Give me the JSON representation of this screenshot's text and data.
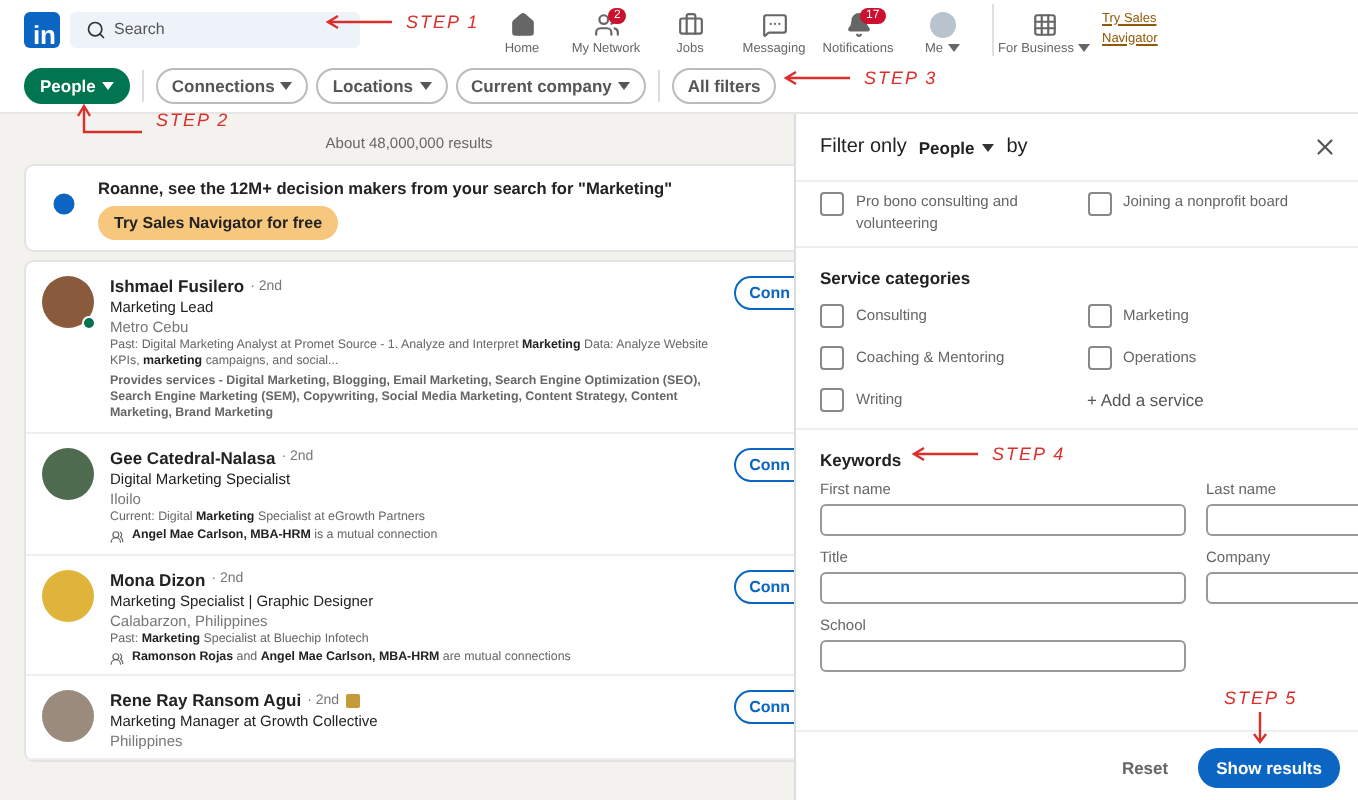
{
  "nav": {
    "logo": "in",
    "search": {
      "placeholder": "Search"
    },
    "items": [
      {
        "kind": "home",
        "label": "Home"
      },
      {
        "kind": "network",
        "label": "My Network",
        "badge": "2"
      },
      {
        "kind": "jobs",
        "label": "Jobs"
      },
      {
        "kind": "messaging",
        "label": "Messaging"
      },
      {
        "kind": "notifications",
        "label": "Notifications",
        "badge": "17"
      },
      {
        "kind": "me",
        "label": "Me"
      },
      {
        "kind": "business",
        "label": "For Business"
      }
    ],
    "premium_link": "Try Sales Navigator"
  },
  "filters": [
    {
      "label": "People",
      "selected": true,
      "dropdown": true
    },
    {
      "label": "Connections",
      "selected": false,
      "dropdown": true
    },
    {
      "label": "Locations",
      "selected": false,
      "dropdown": true
    },
    {
      "label": "Current company",
      "selected": false,
      "dropdown": true
    },
    {
      "label": "All filters",
      "selected": false,
      "dropdown": false
    }
  ],
  "results_count": "About 48,000,000 results",
  "promo": {
    "text": "Roanne, see the 12M+ decision makers from your search for \"Marketing\"",
    "button": "Try Sales Navigator for free"
  },
  "results": [
    {
      "name": "Ishmael Fusilero",
      "degree": "· 2nd",
      "online": true,
      "headline": "Marketing Lead",
      "location": "Metro Cebu",
      "snippet": "Past: Digital Marketing Analyst at Promet Source - 1. Analyze and Interpret **Marketing** Data: Analyze Website KPIs, **marketing** campaigns, and social...",
      "services": "Provides services - Digital Marketing, Blogging, Email Marketing, Search Engine Optimization (SEO), Search Engine Marketing (SEM), Copywriting, Social Media Marketing, Content Strategy, Content Marketing, Brand Marketing",
      "action": "Conn"
    },
    {
      "name": "Gee Catedral-Nalasa",
      "degree": "· 2nd",
      "headline": "Digital Marketing Specialist",
      "location": "Iloilo",
      "snippet": "Current: Digital **Marketing** Specialist at eGrowth Partners",
      "mutual": "**Angel Mae Carlson, MBA-HRM** is a mutual connection",
      "action": "Conn"
    },
    {
      "name": "Mona Dizon",
      "degree": "· 2nd",
      "headline": "Marketing Specialist | Graphic Designer",
      "location": "Calabarzon, Philippines",
      "snippet": "Past: **Marketing** Specialist at Bluechip Infotech",
      "mutual": "**Ramonson Rojas** and **Angel Mae Carlson, MBA-HRM** are mutual connections",
      "action": "Conn"
    },
    {
      "name": "Rene Ray Ransom Agui",
      "degree": "· 2nd",
      "premium": true,
      "headline": "Marketing Manager at Growth Collective",
      "location": "Philippines",
      "action": "Conn"
    }
  ],
  "panel": {
    "title_start": "Filter only",
    "entity": "People",
    "title_end": "by",
    "top_options": [
      {
        "label": "Pro bono consulting and volunteering",
        "checked": false
      },
      {
        "label": "Joining a nonprofit board",
        "checked": false
      }
    ],
    "service_heading": "Service categories",
    "services": [
      {
        "label": "Consulting",
        "checked": false
      },
      {
        "label": "Marketing",
        "checked": false
      },
      {
        "label": "Coaching & Mentoring",
        "checked": false
      },
      {
        "label": "Operations",
        "checked": false
      },
      {
        "label": "Writing",
        "checked": false
      }
    ],
    "add_service": "+ Add a service",
    "keywords_heading": "Keywords",
    "fields": [
      {
        "label": "First name"
      },
      {
        "label": "Last name"
      },
      {
        "label": "Title"
      },
      {
        "label": "Company"
      },
      {
        "label": "School"
      }
    ],
    "reset": "Reset",
    "submit": "Show results"
  },
  "annotations": [
    {
      "text": "STEP 1"
    },
    {
      "text": "STEP 2"
    },
    {
      "text": "STEP 3"
    },
    {
      "text": "STEP 4"
    },
    {
      "text": "STEP 5"
    }
  ]
}
